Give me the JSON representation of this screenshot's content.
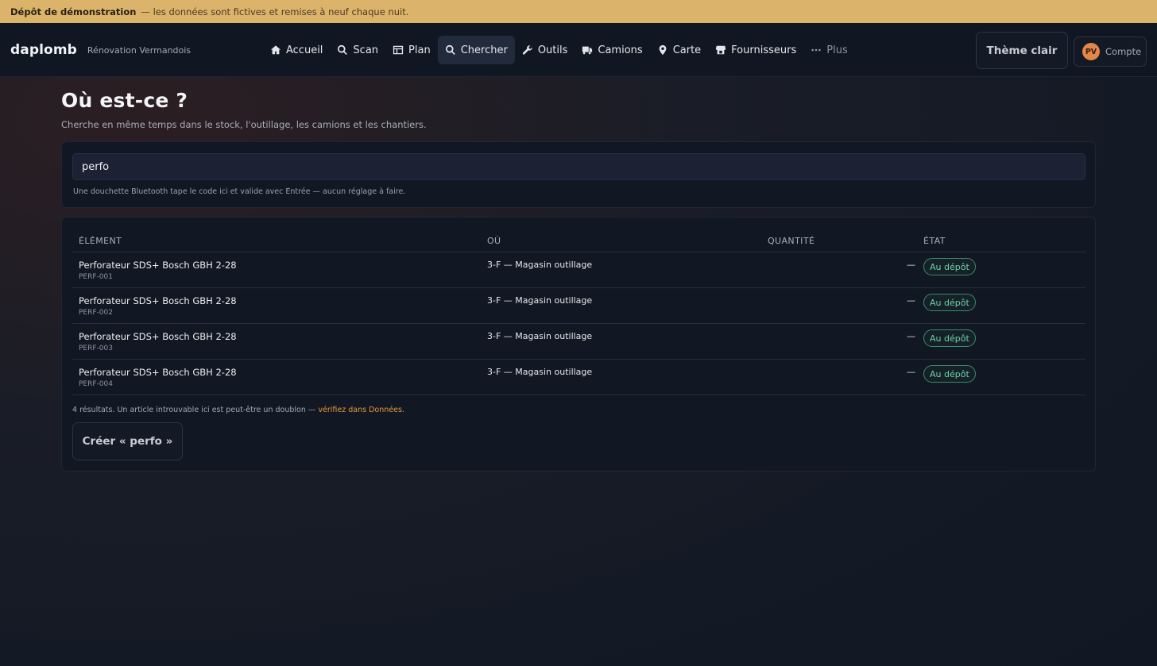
{
  "banner": {
    "title": "Dépôt de démonstration",
    "text": "— les données sont fictives et remises à neuf chaque nuit."
  },
  "brand": {
    "name": "daplomb",
    "organization": "Rénovation Vermandois"
  },
  "nav": {
    "items": [
      {
        "label": "Accueil",
        "icon": "home-icon"
      },
      {
        "label": "Scan",
        "icon": "search-icon"
      },
      {
        "label": "Plan",
        "icon": "plan-icon"
      },
      {
        "label": "Chercher",
        "icon": "search-icon",
        "active": true
      },
      {
        "label": "Outils",
        "icon": "wrench-icon"
      },
      {
        "label": "Camions",
        "icon": "truck-icon"
      },
      {
        "label": "Carte",
        "icon": "map-pin-icon"
      },
      {
        "label": "Fournisseurs",
        "icon": "store-icon"
      },
      {
        "label": "Plus",
        "icon": "more-icon"
      }
    ]
  },
  "header": {
    "theme_button": "Thème clair",
    "account_initials": "PV",
    "account_label": "Compte"
  },
  "page": {
    "title": "Où est-ce ?",
    "subtitle": "Cherche en même temps dans le stock, l'outillage, les camions et les chantiers."
  },
  "search": {
    "value": "perfo",
    "hint": "Une douchette Bluetooth tape le code ici et valide avec Entrée — aucun réglage à faire."
  },
  "results": {
    "columns": {
      "element": "Élément",
      "location": "Où",
      "quantity": "Quantité",
      "status": "État"
    },
    "rows": [
      {
        "name": "Perforateur SDS+ Bosch GBH 2-28",
        "code": "PERF-001",
        "location": "3-F — Magasin outillage",
        "quantity": "—",
        "status": "Au dépôt"
      },
      {
        "name": "Perforateur SDS+ Bosch GBH 2-28",
        "code": "PERF-002",
        "location": "3-F — Magasin outillage",
        "quantity": "—",
        "status": "Au dépôt"
      },
      {
        "name": "Perforateur SDS+ Bosch GBH 2-28",
        "code": "PERF-003",
        "location": "3-F — Magasin outillage",
        "quantity": "—",
        "status": "Au dépôt"
      },
      {
        "name": "Perforateur SDS+ Bosch GBH 2-28",
        "code": "PERF-004",
        "location": "3-F — Magasin outillage",
        "quantity": "—",
        "status": "Au dépôt"
      }
    ],
    "summary": "4 résultats. Un article introuvable ici est peut-être un doublon —",
    "summary_link": "vérifiez dans Données.",
    "create_button": "Créer « perfo »"
  },
  "colors": {
    "banner": "#dcb36a",
    "accent_link": "#e59a3c",
    "status_ok": "#6fd1a9",
    "avatar": "#e2864a"
  }
}
